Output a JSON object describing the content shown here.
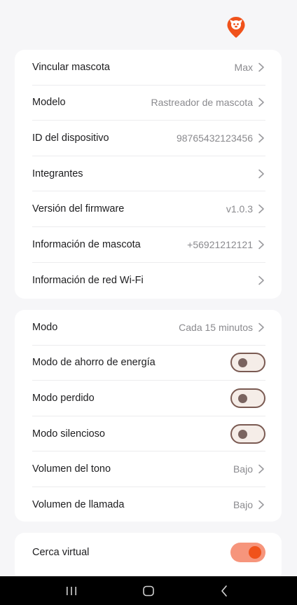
{
  "colors": {
    "accent": "#f0521b",
    "background": "#f6f6f8",
    "card": "#ffffff",
    "value_text": "#8a8a8e"
  },
  "header": {
    "logo_icon": "pet-location-pin-icon"
  },
  "device_info": [
    {
      "label": "Vincular mascota",
      "value": "Max"
    },
    {
      "label": "Modelo",
      "value": "Rastreador de mascota"
    },
    {
      "label": "ID del dispositivo",
      "value": "98765432123456"
    },
    {
      "label": "Integrantes",
      "value": ""
    },
    {
      "label": "Versión del firmware",
      "value": "v1.0.3"
    },
    {
      "label": "Información de mascota",
      "value": "+56921212121"
    },
    {
      "label": "Información de red Wi-Fi",
      "value": ""
    }
  ],
  "settings": {
    "mode": {
      "label": "Modo",
      "value": "Cada 15 minutos"
    },
    "power_saving": {
      "label": "Modo de ahorro de energía",
      "enabled": false
    },
    "lost_mode": {
      "label": "Modo perdido",
      "enabled": false
    },
    "silent_mode": {
      "label": "Modo silencioso",
      "enabled": false
    },
    "ring_volume": {
      "label": "Volumen del tono",
      "value": "Bajo"
    },
    "call_volume": {
      "label": "Volumen de llamada",
      "value": "Bajo"
    }
  },
  "geofence": {
    "label": "Cerca virtual",
    "enabled": true
  },
  "nav": {
    "recents_icon": "recents-icon",
    "home_icon": "home-icon",
    "back_icon": "back-icon"
  }
}
